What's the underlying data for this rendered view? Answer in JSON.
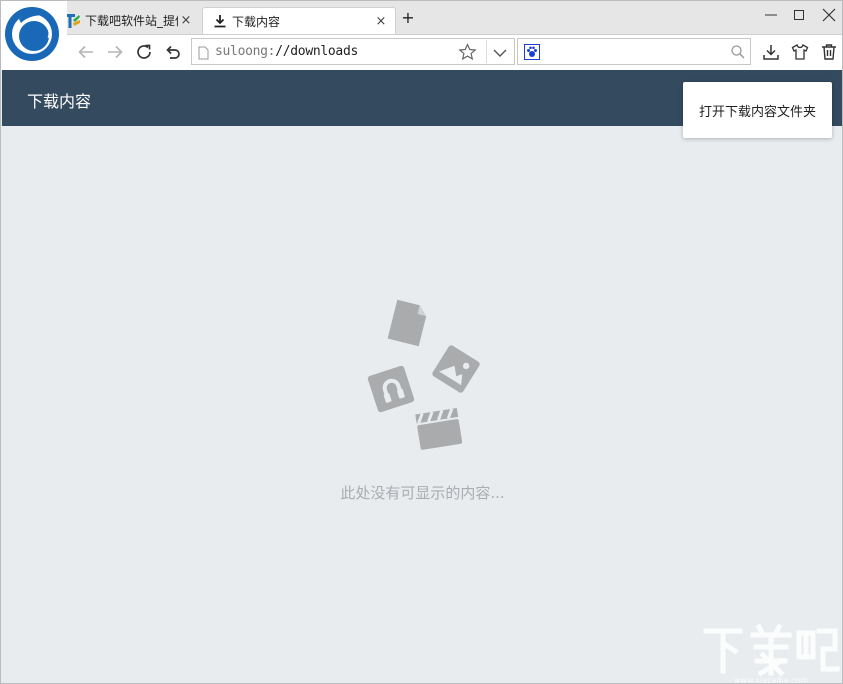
{
  "tabs": [
    {
      "title": "下载吧软件站_提供",
      "close": "×"
    },
    {
      "title": "下载内容",
      "close": "×"
    }
  ],
  "new_tab_label": "+",
  "address_bar": {
    "scheme": "suloong:",
    "path": "//downloads"
  },
  "page": {
    "header_title": "下载内容",
    "open_folder_button": "打开下载内容文件夹",
    "empty_message": "此处没有可显示的内容..."
  },
  "colors": {
    "header": "#344a5f",
    "background": "#e8ecef",
    "illustration": "#a9abad"
  }
}
